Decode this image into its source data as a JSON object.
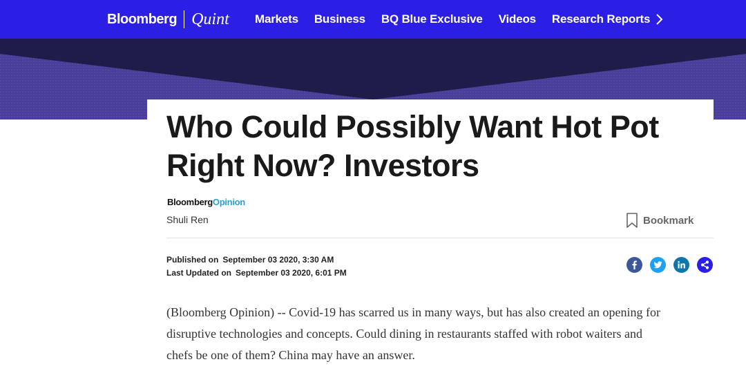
{
  "brand": {
    "name_left": "Bloomberg",
    "name_right": "Quint"
  },
  "nav": {
    "items": [
      "Markets",
      "Business",
      "BQ Blue Exclusive",
      "Videos",
      "Research Reports"
    ],
    "more_icon": "chevron-right-icon"
  },
  "article": {
    "headline_line1": "Who Could Possibly Want Hot Pot",
    "headline_line2": "Right Now? Investors",
    "section_brand_left": "Bloomberg",
    "section_brand_right": "Opinion",
    "author": "Shuli Ren",
    "bookmark_label": "Bookmark",
    "published_label": "Published on",
    "published_value": "September 03 2020, 3:30 AM",
    "updated_label": "Last Updated on",
    "updated_value": "September 03 2020, 6:01 PM",
    "body_line1": "(Bloomberg Opinion) -- Covid-19 has scarred us in many ways, but has also created an opening for",
    "body_line2": "disruptive technologies and concepts. Could dining in restaurants staffed with robot waiters and",
    "body_line3": "chefs be one of them? China may have an answer."
  },
  "share": {
    "icons": [
      "facebook-icon",
      "twitter-icon",
      "linkedin-icon",
      "share-icon"
    ]
  },
  "colors": {
    "nav_bg": "#2b1fe6",
    "banner_dark": "#1f1c4a",
    "banner_purple": "#4a3f98",
    "opinion_accent": "#2a9fd8"
  }
}
